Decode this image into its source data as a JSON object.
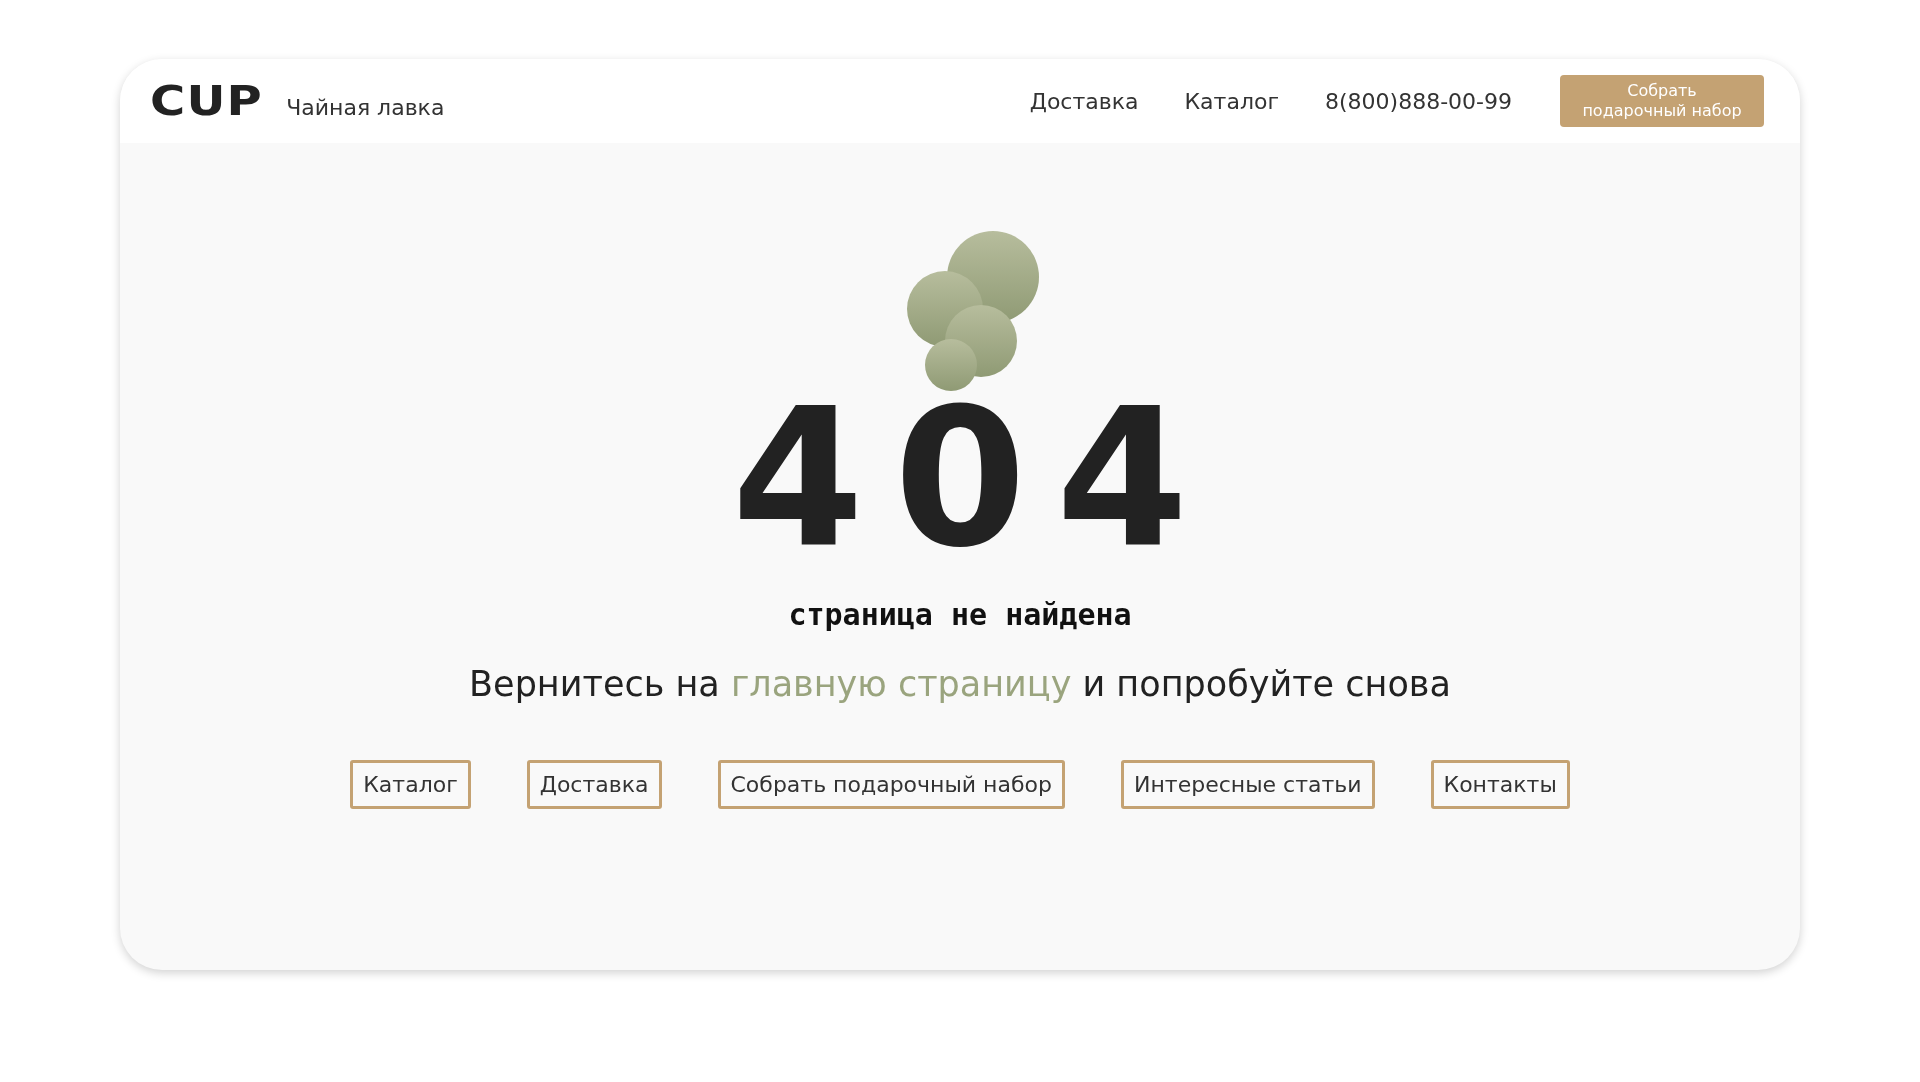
{
  "header": {
    "logo": "CUP",
    "shop_name": "Чайная лавка",
    "nav": [
      "Доставка",
      "Каталог"
    ],
    "phone": "8(800)888-00-99",
    "cta_button": "Собрать подарочный набор"
  },
  "error": {
    "code": "404",
    "title": "страница не найдена"
  },
  "message": {
    "before": "Вернитесь на ",
    "link": "главную страницу",
    "after": " и попробуйте снова"
  },
  "links": [
    "Каталог",
    "Доставка",
    "Собрать подарочный набор",
    "Интересные статьи",
    "Контакты"
  ]
}
